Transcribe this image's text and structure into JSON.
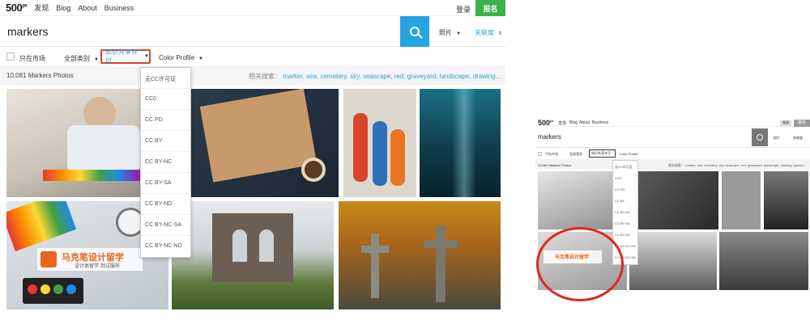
{
  "header": {
    "logo": "500",
    "logo_sup": "px",
    "nav": [
      "发现",
      "Blog",
      "About",
      "Business"
    ],
    "login": "登录",
    "signup": "报名"
  },
  "search": {
    "query": "markers",
    "type_select": "照片",
    "sort_select": "关联度"
  },
  "filters": {
    "market_only": "只在市场",
    "category": "全部类别",
    "license": "知识共享许可",
    "color": "Color Profile"
  },
  "results": {
    "count": "10,081 Markers Photos",
    "related_label": "相关搜索：",
    "related_tags": "marker, sea, cemetery, sky, seascape, red, graveyard, landscape, drawing, graves..."
  },
  "license_dropdown": {
    "options": [
      "无CC许可证",
      "CC0",
      "CC PD",
      "CC BY",
      "CC BY-NC",
      "CC BY-SA",
      "CC BY-ND",
      "CC BY-NC-SA",
      "CC BY-NC-ND"
    ]
  },
  "watermark": {
    "text": "马克笔设计留学",
    "subtext": "设计类留学·到试服务"
  },
  "colors": {
    "accent_blue": "#24a4e0",
    "signup_green": "#3cb14a",
    "highlight_red": "#d9452a",
    "annotation_circle": "#e0261f"
  }
}
